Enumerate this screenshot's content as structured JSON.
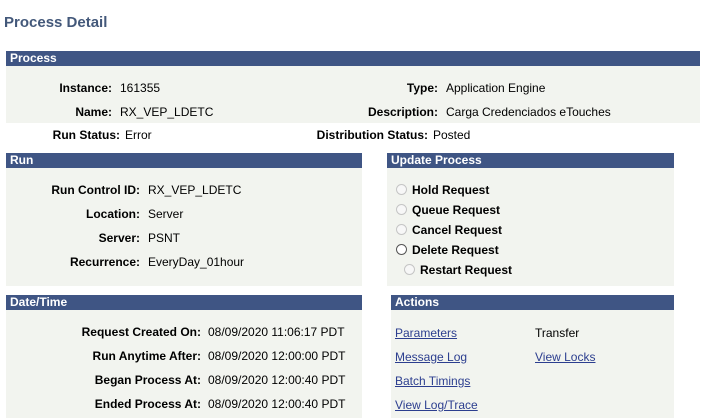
{
  "page_title": "Process Detail",
  "process": {
    "header": "Process",
    "instance_label": "Instance:",
    "instance_value": "161355",
    "type_label": "Type:",
    "type_value": "Application Engine",
    "name_label": "Name:",
    "name_value": "RX_VEP_LDETC",
    "description_label": "Description:",
    "description_value": "Carga Credenciados eTouches",
    "run_status_label": "Run Status:",
    "run_status_value": "Error",
    "dist_status_label": "Distribution Status:",
    "dist_status_value": "Posted"
  },
  "run": {
    "header": "Run",
    "run_control_label": "Run Control ID:",
    "run_control_value": "RX_VEP_LDETC",
    "location_label": "Location:",
    "location_value": "Server",
    "server_label": "Server:",
    "server_value": "PSNT",
    "recurrence_label": "Recurrence:",
    "recurrence_value": "EveryDay_01hour"
  },
  "update_process": {
    "header": "Update Process",
    "options": [
      {
        "label": "Hold Request",
        "enabled": false
      },
      {
        "label": "Queue Request",
        "enabled": false
      },
      {
        "label": "Cancel Request",
        "enabled": false
      },
      {
        "label": "Delete Request",
        "enabled": true
      },
      {
        "label": "Restart Request",
        "enabled": false
      }
    ]
  },
  "datetime": {
    "header": "Date/Time",
    "created_label": "Request Created On:",
    "created_value": "08/09/2020 11:06:17 PDT",
    "run_after_label": "Run Anytime After:",
    "run_after_value": "08/09/2020 12:00:00 PDT",
    "began_label": "Began Process At:",
    "began_value": "08/09/2020 12:00:40 PDT",
    "ended_label": "Ended Process At:",
    "ended_value": "08/09/2020 12:00:40 PDT"
  },
  "actions": {
    "header": "Actions",
    "parameters": "Parameters",
    "transfer": "Transfer",
    "message_log": "Message Log",
    "view_locks": "View Locks",
    "batch_timings": "Batch Timings",
    "view_log_trace": "View Log/Trace"
  }
}
